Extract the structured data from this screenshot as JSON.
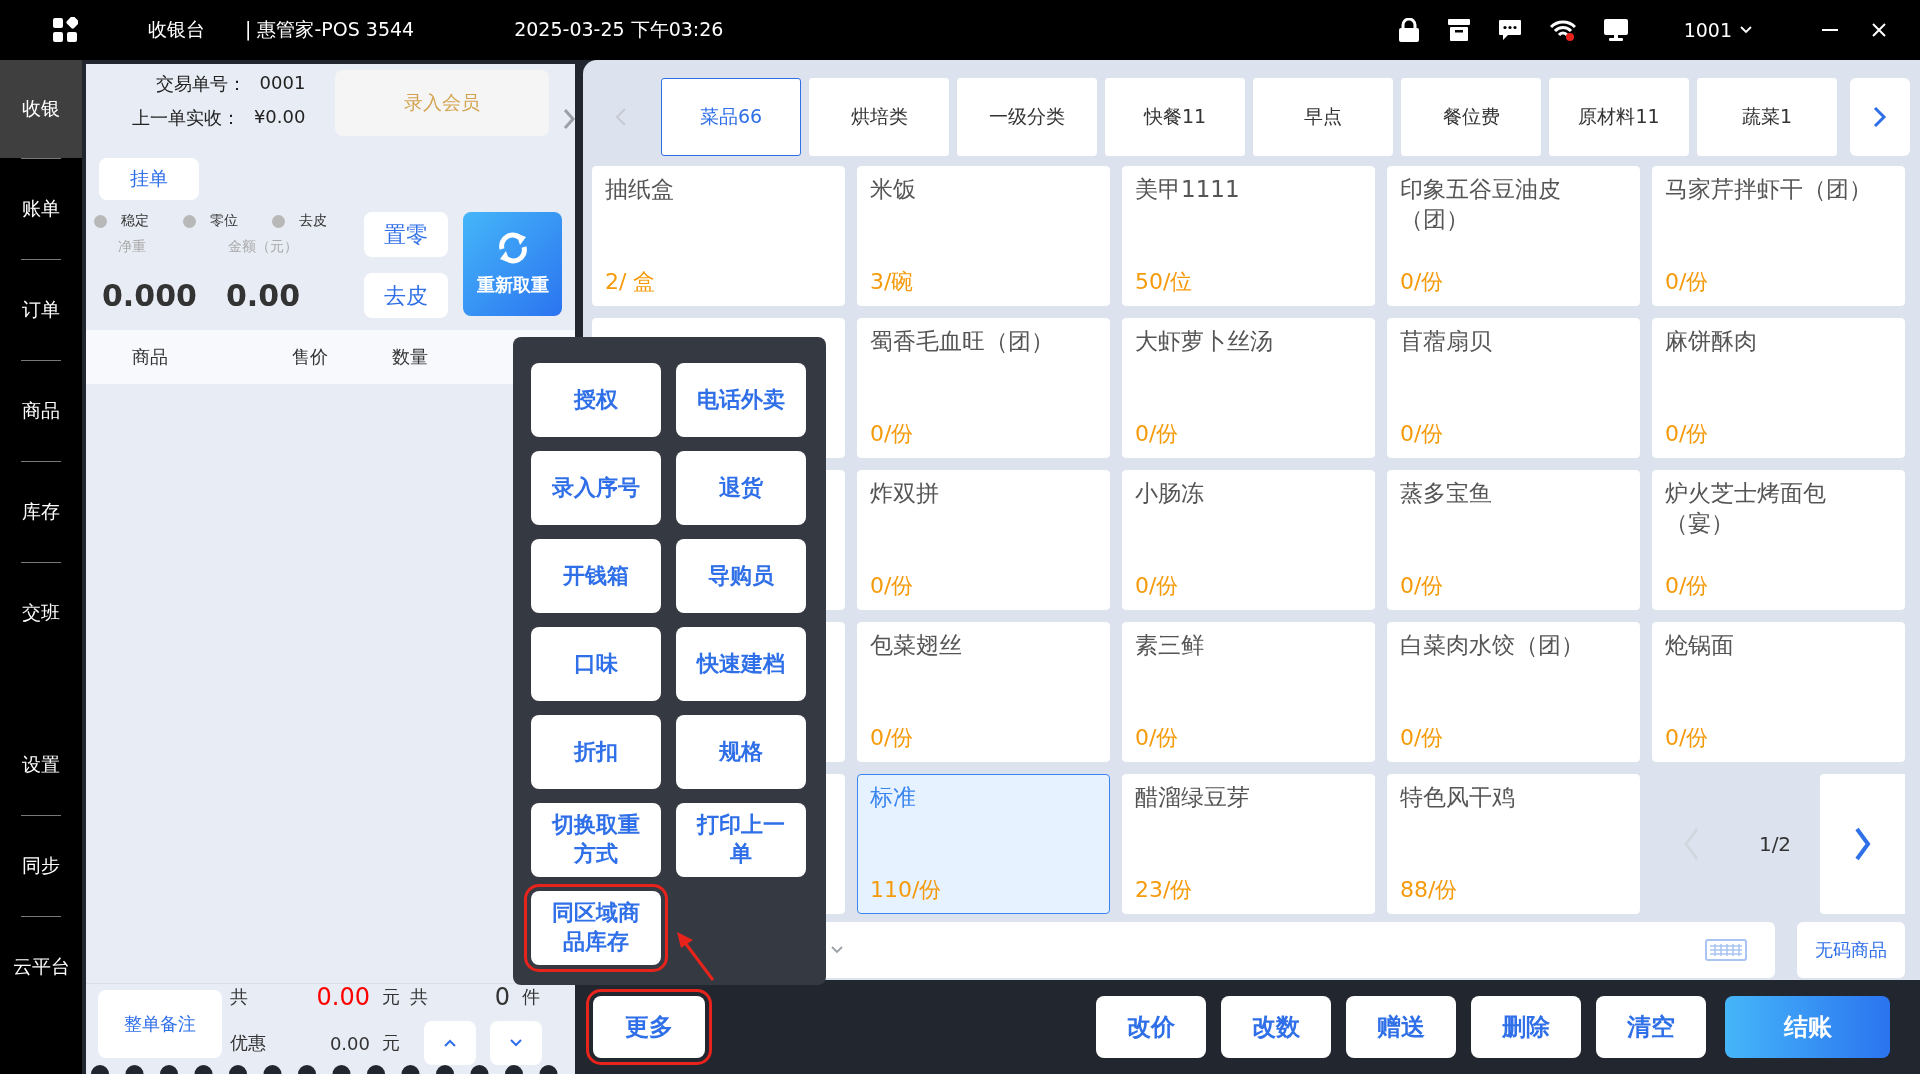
{
  "top_bar": {
    "title": "收银台",
    "store": "| 惠管家-POS 3544",
    "datetime": "2025-03-25 下午03:26",
    "user": "1001"
  },
  "sidebar": {
    "items": [
      {
        "label": "收银",
        "selected": true
      },
      {
        "label": "账单",
        "selected": false
      },
      {
        "label": "订单",
        "selected": false
      },
      {
        "label": "商品",
        "selected": false
      },
      {
        "label": "库存",
        "selected": false
      },
      {
        "label": "交班",
        "selected": false
      }
    ],
    "bottom_items": [
      {
        "label": "设置",
        "selected": false
      },
      {
        "label": "同步",
        "selected": false
      },
      {
        "label": "云平台",
        "selected": false
      }
    ]
  },
  "order_panel": {
    "order_no_label": "交易单号：",
    "order_no": "0001",
    "last_label": "上一单实收：",
    "last_amount": "¥0.00",
    "member_button": "录入会员",
    "hold_button": "挂单",
    "indicators": [
      {
        "label": "稳定",
        "on": false
      },
      {
        "label": "零位",
        "on": false
      },
      {
        "label": "去皮",
        "on": false
      }
    ],
    "weight_label": "净重",
    "amount_label": "金额（元）",
    "weight": "0.000",
    "amount": "0.00",
    "zero_button": "置零",
    "tare_button": "去皮",
    "reweigh_button": "重新取重",
    "columns": [
      "商品",
      "售价",
      "数量"
    ],
    "note_button": "整单备注",
    "total_label": "共",
    "total": "0.00",
    "total_unit": "元",
    "count_label": "共",
    "count": "0",
    "count_unit": "件",
    "discount_label": "优惠",
    "discount": "0.00",
    "discount_unit": "元"
  },
  "category_tabs": [
    {
      "label": "菜品66",
      "selected": true
    },
    {
      "label": "烘培类",
      "selected": false
    },
    {
      "label": "一级分类",
      "selected": false
    },
    {
      "label": "快餐11",
      "selected": false
    },
    {
      "label": "早点",
      "selected": false
    },
    {
      "label": "餐位费",
      "selected": false
    },
    {
      "label": "原材料11",
      "selected": false
    },
    {
      "label": "蔬菜1",
      "selected": false
    }
  ],
  "products": [
    {
      "kind": "card",
      "name": "抽纸盒",
      "stock": "2/ 盒",
      "selected": false
    },
    {
      "kind": "card",
      "name": "米饭",
      "stock": "3/碗",
      "selected": false
    },
    {
      "kind": "card",
      "name": "美甲1111",
      "stock": "50/位",
      "selected": false
    },
    {
      "kind": "card",
      "name": "印象五谷豆油皮（团）",
      "stock": "0/份",
      "selected": false
    },
    {
      "kind": "card",
      "name": "马家芹拌虾干（团）",
      "stock": "0/份",
      "selected": false
    },
    {
      "kind": "covered"
    },
    {
      "kind": "card",
      "name": "蜀香毛血旺（团）",
      "stock": "0/份",
      "selected": false
    },
    {
      "kind": "card",
      "name": "大虾萝卜丝汤",
      "stock": "0/份",
      "selected": false
    },
    {
      "kind": "card",
      "name": "苜蓿扇贝",
      "stock": "0/份",
      "selected": false
    },
    {
      "kind": "card",
      "name": "麻饼酥肉",
      "stock": "0/份",
      "selected": false
    },
    {
      "kind": "covered"
    },
    {
      "kind": "card",
      "name": "炸双拼",
      "stock": "0/份",
      "selected": false
    },
    {
      "kind": "card",
      "name": "小肠冻",
      "stock": "0/份",
      "selected": false
    },
    {
      "kind": "card",
      "name": "蒸多宝鱼",
      "stock": "0/份",
      "selected": false
    },
    {
      "kind": "card",
      "name": "炉火芝士烤面包（宴）",
      "stock": "0/份",
      "selected": false
    },
    {
      "kind": "covered"
    },
    {
      "kind": "card",
      "name": "包菜翅丝",
      "stock": "0/份",
      "selected": false
    },
    {
      "kind": "card",
      "name": "素三鲜",
      "stock": "0/份",
      "selected": false
    },
    {
      "kind": "card",
      "name": "白菜肉水饺（团）",
      "stock": "0/份",
      "selected": false
    },
    {
      "kind": "card",
      "name": "炝锅面",
      "stock": "0/份",
      "selected": false
    },
    {
      "kind": "covered"
    },
    {
      "kind": "card",
      "name": "标准",
      "stock": "110/份",
      "selected": true
    },
    {
      "kind": "card",
      "name": "醋溜绿豆芽",
      "stock": "23/份",
      "selected": false
    },
    {
      "kind": "card",
      "name": "特色风干鸡",
      "stock": "88/份",
      "selected": false
    },
    {
      "kind": "pager",
      "page": "1/2"
    }
  ],
  "search": {
    "button": "无码商品"
  },
  "more_menu": {
    "items": [
      {
        "label": "授权",
        "annotated": false
      },
      {
        "label": "电话外卖",
        "annotated": false
      },
      {
        "label": "录入序号",
        "annotated": false
      },
      {
        "label": "退货",
        "annotated": false
      },
      {
        "label": "开钱箱",
        "annotated": false
      },
      {
        "label": "导购员",
        "annotated": false
      },
      {
        "label": "口味",
        "annotated": false
      },
      {
        "label": "快速建档",
        "annotated": false
      },
      {
        "label": "折扣",
        "annotated": false
      },
      {
        "label": "规格",
        "annotated": false
      },
      {
        "label": "切换取重方式",
        "annotated": false
      },
      {
        "label": "打印上一单",
        "annotated": false
      },
      {
        "label": "同区域商品库存",
        "annotated": true
      }
    ]
  },
  "actions": {
    "more": {
      "label": "更多",
      "annotated": true
    },
    "buttons": [
      {
        "label": "改价",
        "kind": "plain"
      },
      {
        "label": "改数",
        "kind": "plain"
      },
      {
        "label": "赠送",
        "kind": "plain"
      },
      {
        "label": "删除",
        "kind": "plain"
      },
      {
        "label": "清空",
        "kind": "plain"
      },
      {
        "label": "结账",
        "kind": "primary"
      }
    ]
  }
}
